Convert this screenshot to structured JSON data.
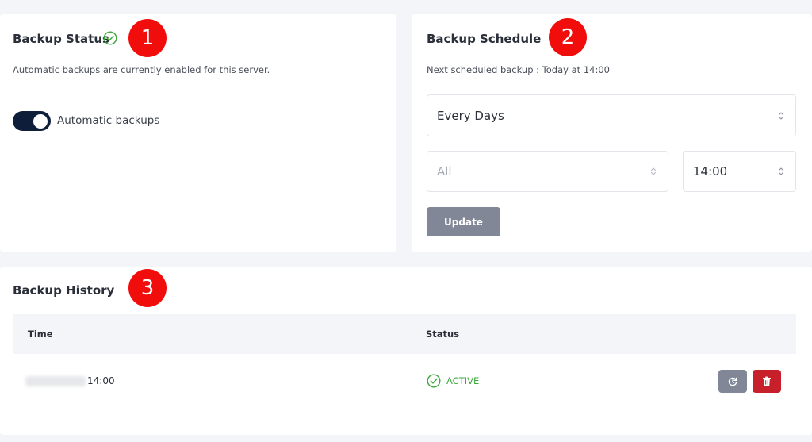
{
  "colors": {
    "page_bg": "#f4f5f9",
    "card_bg": "#ffffff",
    "toggle_on": "#0e1d3a",
    "badge": "#f20d0d",
    "success": "#3aa83a",
    "button_gray": "#818796",
    "button_danger": "#c8202a"
  },
  "badges": [
    "1",
    "2",
    "3"
  ],
  "backup_status": {
    "title": "Backup Status",
    "title_icon": "check-circle-icon",
    "description": "Automatic backups are currently enabled for this server.",
    "toggle_label": "Automatic backups",
    "toggle_on": true
  },
  "backup_schedule": {
    "title": "Backup Schedule",
    "next_backup": "Next scheduled backup : Today at 14:00",
    "frequency_value": "Every Days",
    "day_value": "All",
    "time_value": "14:00",
    "update_label": "Update"
  },
  "backup_history": {
    "title": "Backup History",
    "columns": [
      "Time",
      "Status"
    ],
    "rows": [
      {
        "time": "14:00",
        "status": "ACTIVE",
        "status_icon": "check-circle-icon",
        "actions": [
          "restore-icon",
          "trash-icon"
        ]
      }
    ]
  }
}
